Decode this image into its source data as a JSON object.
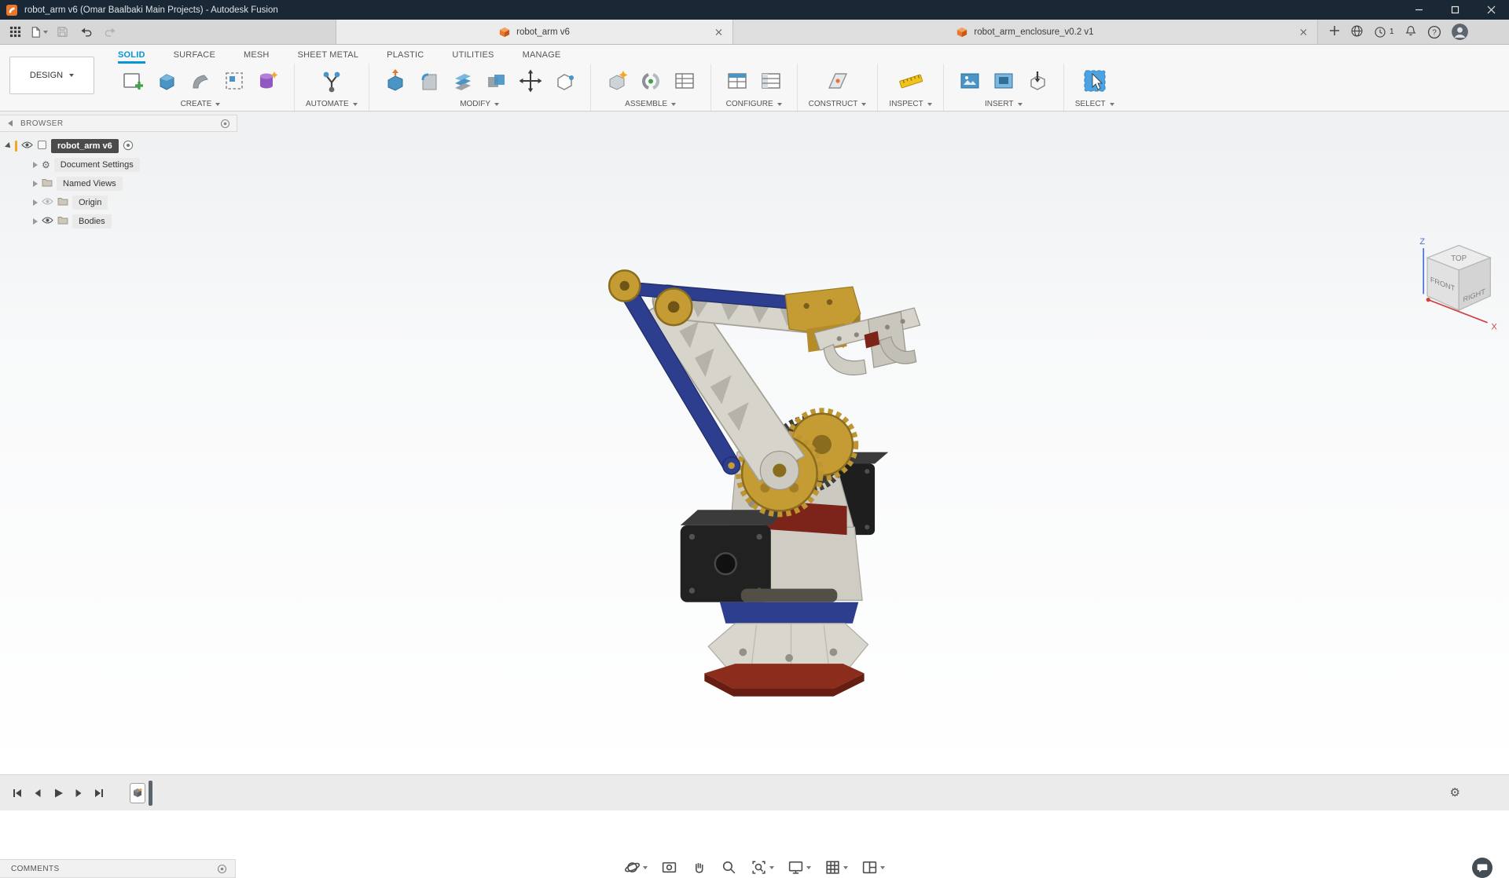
{
  "title_bar": {
    "title": "robot_arm v6 (Omar Baalbaki Main Projects) - Autodesk Fusion"
  },
  "header": {
    "job_count": "1"
  },
  "document_tabs": [
    {
      "label": "robot_arm v6",
      "active": true
    },
    {
      "label": "robot_arm_enclosure_v0.2 v1",
      "active": false
    }
  ],
  "ribbon": {
    "workspace": "DESIGN",
    "tabs": [
      {
        "label": "SOLID",
        "active": true
      },
      {
        "label": "SURFACE",
        "active": false
      },
      {
        "label": "MESH",
        "active": false
      },
      {
        "label": "SHEET METAL",
        "active": false
      },
      {
        "label": "PLASTIC",
        "active": false
      },
      {
        "label": "UTILITIES",
        "active": false
      },
      {
        "label": "MANAGE",
        "active": false
      }
    ],
    "groups": [
      {
        "label": "CREATE"
      },
      {
        "label": "AUTOMATE"
      },
      {
        "label": "MODIFY"
      },
      {
        "label": "ASSEMBLE"
      },
      {
        "label": "CONFIGURE"
      },
      {
        "label": "CONSTRUCT"
      },
      {
        "label": "INSPECT"
      },
      {
        "label": "INSERT"
      },
      {
        "label": "SELECT"
      }
    ]
  },
  "browser": {
    "header": "BROWSER",
    "root": {
      "label": "robot_arm v6"
    },
    "items": [
      {
        "label": "Document Settings",
        "icon": "gear-icon"
      },
      {
        "label": "Named Views",
        "icon": "folder-icon"
      },
      {
        "label": "Origin",
        "icon": "folder-icon",
        "visibility": "hidden"
      },
      {
        "label": "Bodies",
        "icon": "folder-icon",
        "visibility": "visible"
      }
    ]
  },
  "viewcube": {
    "top": "TOP",
    "front": "FRONT",
    "right": "RIGHT",
    "axis_z": "Z",
    "axis_x": "X"
  },
  "comments_panel": {
    "label": "COMMENTS"
  },
  "icons": {
    "help_glyph": "?",
    "gear_glyph": "⚙"
  },
  "colors": {
    "titlebar": "#1a2734",
    "accent_blue": "#0696d7",
    "fusion_orange": "#e8762d",
    "model_blue": "#2e3e8e",
    "model_gold": "#c59b33",
    "model_red": "#7c241a",
    "model_ivory": "#d7d4cb"
  }
}
